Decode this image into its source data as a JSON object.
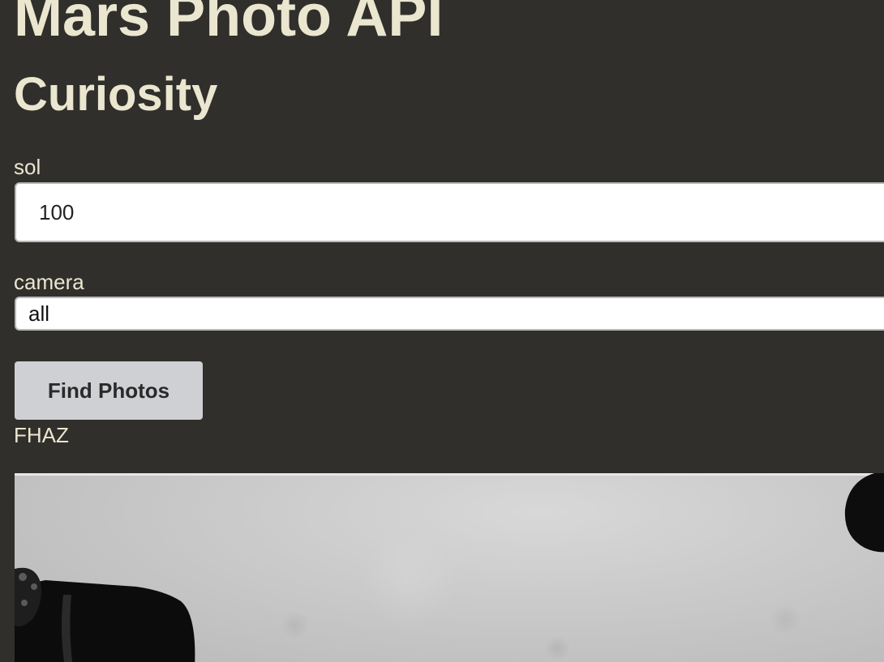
{
  "header": {
    "title": "Mars Photo API",
    "rover": "Curiosity"
  },
  "form": {
    "sol_label": "sol",
    "sol_value": "100",
    "camera_label": "camera",
    "camera_value": "all",
    "submit_label": "Find Photos"
  },
  "results": {
    "camera_name": "FHAZ",
    "photo_alt": "FHAZ"
  },
  "colors": {
    "background": "#302f2c",
    "heading_text": "#ebe6cf",
    "button_bg": "#cfd0d4"
  }
}
